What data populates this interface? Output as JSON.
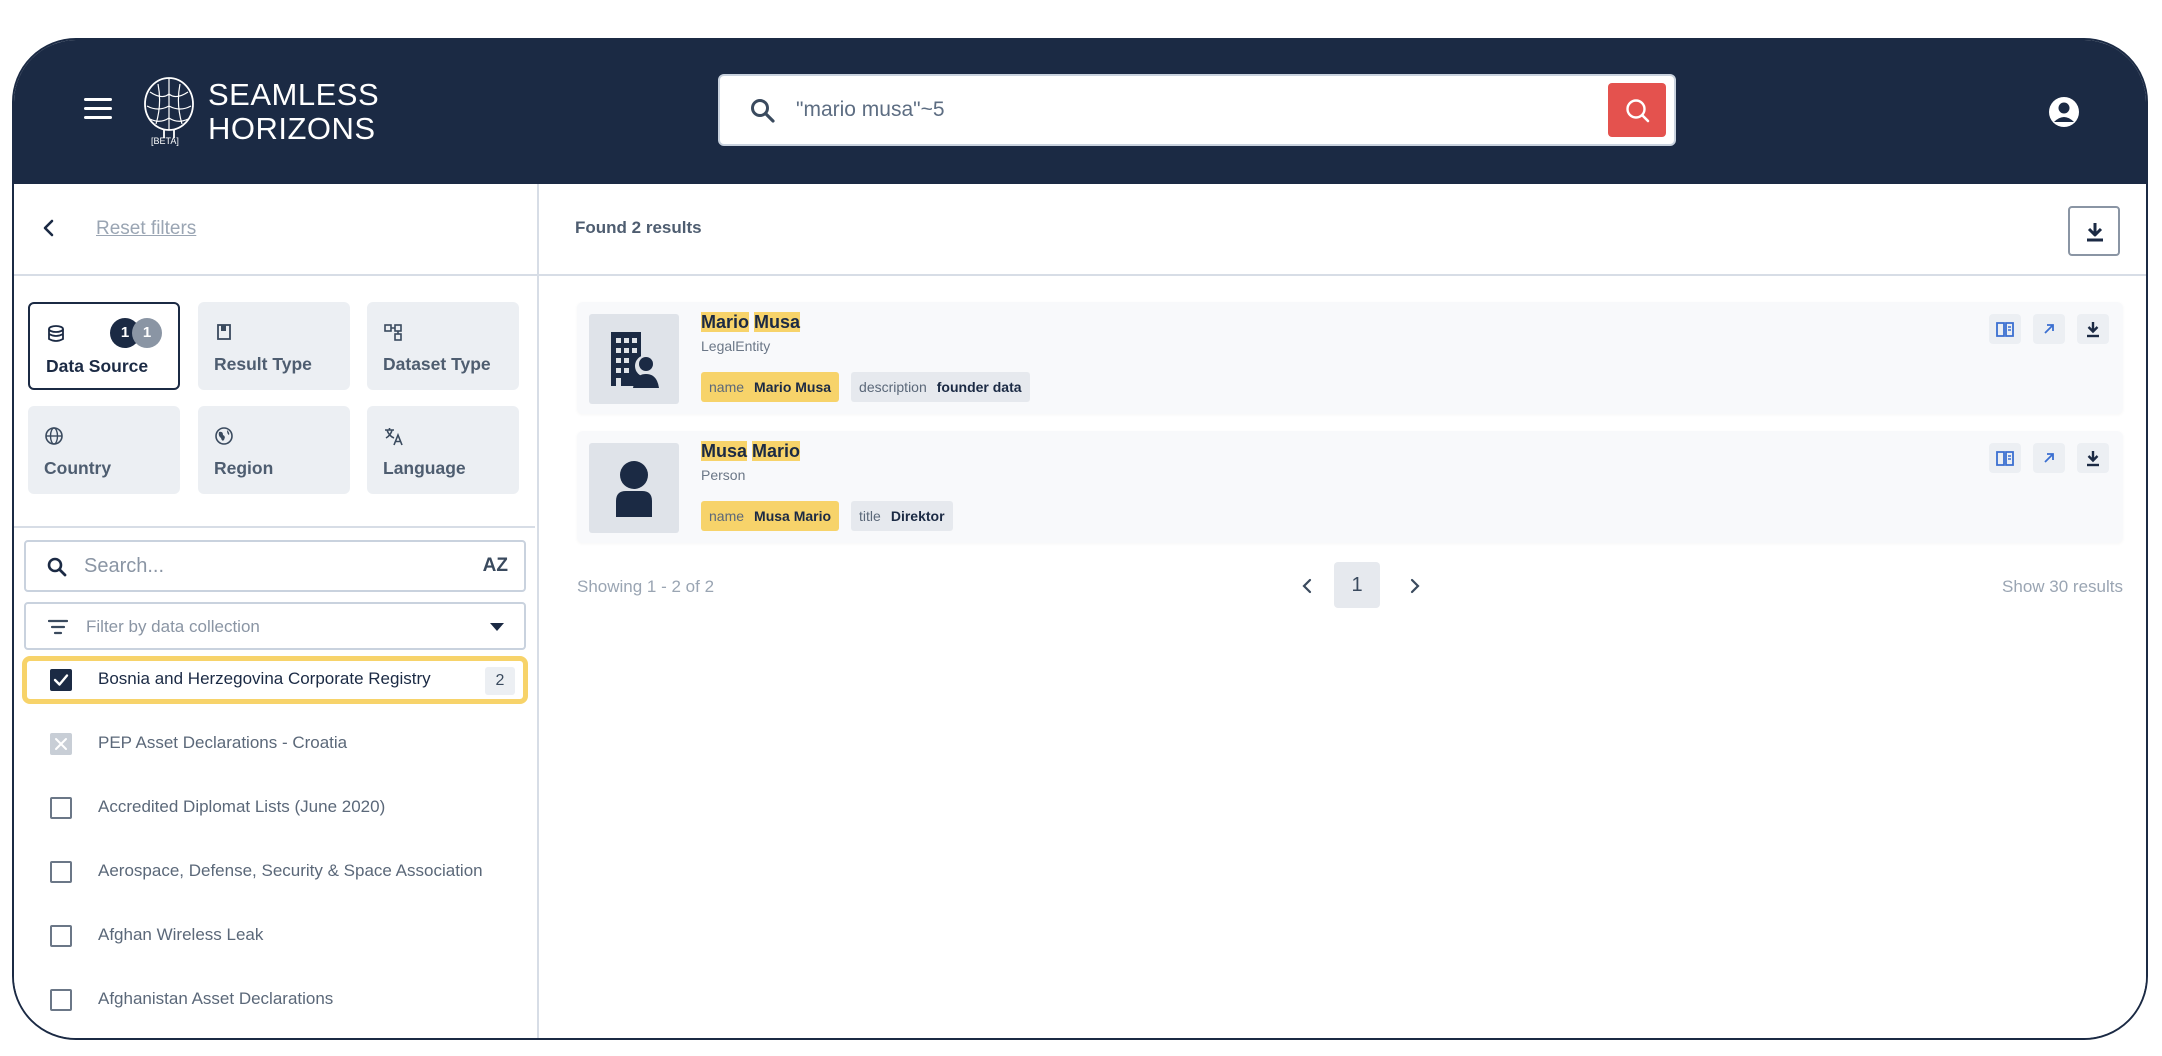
{
  "header": {
    "logo_line1": "SEAMLESS",
    "logo_line2": "HORIZONS",
    "logo_badge": "[BETA]",
    "search_query": "\"mario musa\"~5"
  },
  "sidebar": {
    "reset_label": "Reset filters",
    "tiles": [
      {
        "label": "Data Source",
        "badge_selected": "1",
        "badge_total": "1",
        "icon": "database-icon"
      },
      {
        "label": "Result Type",
        "icon": "bookmark-icon"
      },
      {
        "label": "Dataset Type",
        "icon": "dataset-icon"
      },
      {
        "label": "Country",
        "icon": "globe-icon"
      },
      {
        "label": "Region",
        "icon": "region-icon"
      },
      {
        "label": "Language",
        "icon": "translate-icon"
      }
    ],
    "search_placeholder": "Search...",
    "sort_label": "AZ",
    "collection_placeholder": "Filter by data collection",
    "datasets": [
      {
        "label": "Bosnia and Herzegovina Corporate Registry",
        "count": "2",
        "state": "checked"
      },
      {
        "label": "PEP Asset Declarations - Croatia",
        "state": "disabled"
      },
      {
        "label": "Accredited Diplomat Lists (June 2020)",
        "state": "unchecked"
      },
      {
        "label": "Aerospace, Defense, Security & Space Association",
        "state": "unchecked"
      },
      {
        "label": "Afghan Wireless Leak",
        "state": "unchecked"
      },
      {
        "label": "Afghanistan Asset Declarations",
        "state": "unchecked"
      }
    ]
  },
  "results": {
    "found_label": "Found 2 results",
    "items": [
      {
        "title_a": "Mario",
        "title_b": "Musa",
        "type": "LegalEntity",
        "chips": [
          {
            "key": "name",
            "value": "Mario Musa",
            "highlight": true
          },
          {
            "key": "description",
            "value": "founder data",
            "highlight": false
          }
        ]
      },
      {
        "title_a": "Musa",
        "title_b": "Mario",
        "type": "Person",
        "chips": [
          {
            "key": "name",
            "value": "Musa Mario",
            "highlight": true
          },
          {
            "key": "title",
            "value": "Direktor",
            "highlight": false
          }
        ]
      }
    ],
    "pagination": {
      "showing": "Showing 1 - 2 of 2",
      "page": "1",
      "show_count": "Show 30 results"
    }
  },
  "colors": {
    "navy": "#1b2a44",
    "accent_red": "#e4524e",
    "highlight_yellow": "#f7d36a"
  }
}
